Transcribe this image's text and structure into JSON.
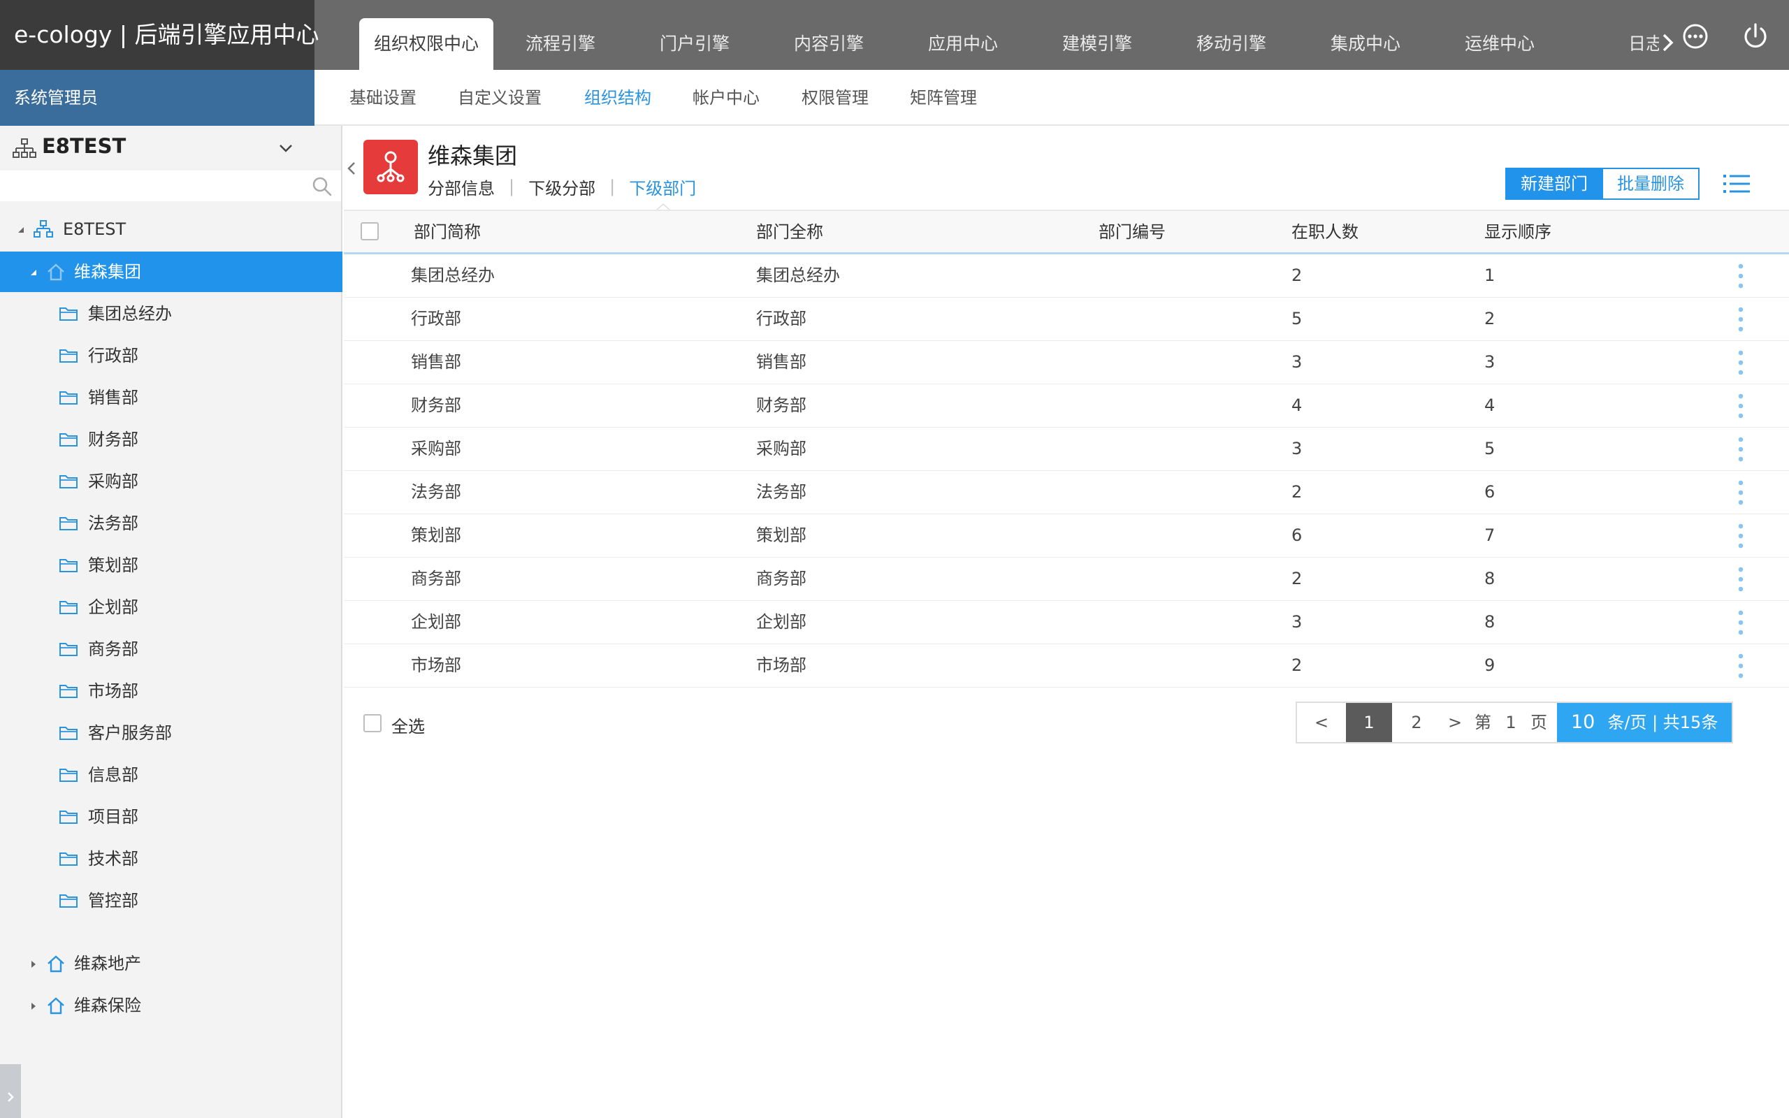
{
  "app": {
    "title": "e-cology | 后端引擎应用中心",
    "role": "系统管理员"
  },
  "main_tabs": [
    {
      "label": "组织权限中心",
      "active": true
    },
    {
      "label": "流程引擎"
    },
    {
      "label": "门户引擎"
    },
    {
      "label": "内容引擎"
    },
    {
      "label": "应用中心"
    },
    {
      "label": "建模引擎"
    },
    {
      "label": "移动引擎"
    },
    {
      "label": "集成中心"
    },
    {
      "label": "运维中心"
    }
  ],
  "main_tab_more": "日志",
  "sub_nav": [
    {
      "label": "基础设置"
    },
    {
      "label": "自定义设置"
    },
    {
      "label": "组织结构",
      "active": true
    },
    {
      "label": "帐户中心"
    },
    {
      "label": "权限管理"
    },
    {
      "label": "矩阵管理"
    }
  ],
  "sidebar": {
    "company": "E8TEST",
    "search_placeholder": "",
    "tree": {
      "root": "E8TEST",
      "selected": "维森集团",
      "departments": [
        "集团总经办",
        "行政部",
        "销售部",
        "财务部",
        "采购部",
        "法务部",
        "策划部",
        "企划部",
        "商务部",
        "市场部",
        "客户服务部",
        "信息部",
        "项目部",
        "技术部",
        "管控部"
      ],
      "siblings": [
        "维森地产",
        "维森保险"
      ]
    }
  },
  "org": {
    "name": "维森集团",
    "tabs": [
      {
        "label": "分部信息"
      },
      {
        "label": "下级分部"
      },
      {
        "label": "下级部门",
        "active": true
      }
    ]
  },
  "actions": {
    "new_dept": "新建部门",
    "batch_delete": "批量删除"
  },
  "table": {
    "columns": [
      "部门简称",
      "部门全称",
      "部门编号",
      "在职人数",
      "显示顺序"
    ],
    "rows": [
      [
        "集团总经办",
        "集团总经办",
        "",
        "2",
        "1"
      ],
      [
        "行政部",
        "行政部",
        "",
        "5",
        "2"
      ],
      [
        "销售部",
        "销售部",
        "",
        "3",
        "3"
      ],
      [
        "财务部",
        "财务部",
        "",
        "4",
        "4"
      ],
      [
        "采购部",
        "采购部",
        "",
        "3",
        "5"
      ],
      [
        "法务部",
        "法务部",
        "",
        "2",
        "6"
      ],
      [
        "策划部",
        "策划部",
        "",
        "6",
        "7"
      ],
      [
        "商务部",
        "商务部",
        "",
        "2",
        "8"
      ],
      [
        "企划部",
        "企划部",
        "",
        "3",
        "8"
      ],
      [
        "市场部",
        "市场部",
        "",
        "2",
        "9"
      ]
    ]
  },
  "footer": {
    "select_all": "全选",
    "pager": {
      "prev": "<",
      "next": ">",
      "pages": [
        "1",
        "2"
      ],
      "current": "1",
      "goto_prefix": "第",
      "goto_value": "1",
      "goto_suffix": "页",
      "page_size": "10",
      "size_suffix": "条/页 | 共15条"
    }
  },
  "colors": {
    "topbar": "#6a6a6a",
    "brand_bg": "#3b3b3b",
    "role_bg": "#3a6c9c",
    "accent": "#2293ea",
    "badge": "#e63b3b"
  },
  "icons": [
    "power-icon",
    "more-options-icon",
    "search-icon",
    "org-structure-icon",
    "folder-icon",
    "home-icon",
    "list-menu-icon"
  ]
}
